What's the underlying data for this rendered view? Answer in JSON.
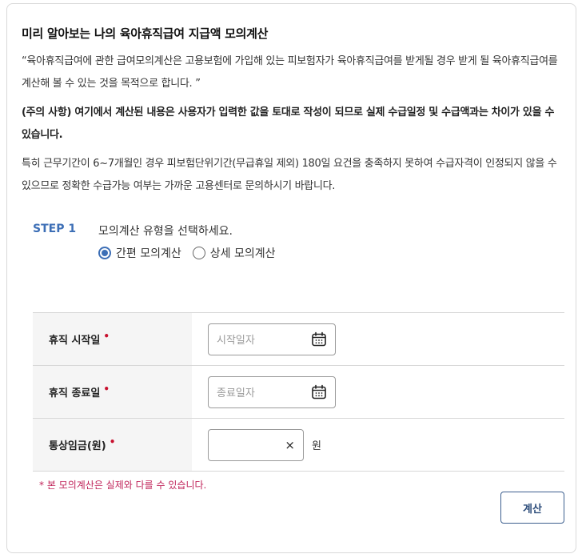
{
  "title": "미리 알아보는 나의 육아휴직급여 지급액 모의계산",
  "intro": "“육아휴직급여에 관한 급여모의계산은 고용보험에 가입해 있는 피보험자가 육아휴직급여를 받게될 경우 받게 될 육아휴직급여를 계산해 볼 수 있는 것을 목적으로 합니다. ”",
  "caution": "(주의 사항) 여기에서 계산된 내용은 사용자가 입력한 값을 토대로 작성이 되므로 실제 수급일정 및 수급액과는 차이가 있을 수 있습니다.",
  "notice": "특히 근무기간이 6~7개월인 경우 피보험단위기간(무급휴일 제외) 180일 요건을 충족하지 못하여 수급자격이 인정되지 않을 수 있으므로 정확한 수급가능 여부는 가까운 고용센터로 문의하시기 바랍니다.",
  "step": {
    "label": "STEP 1",
    "instruction": "모의계산 유형을 선택하세요.",
    "options": [
      {
        "label": "간편 모의계산",
        "selected": true
      },
      {
        "label": "상세 모의계산",
        "selected": false
      }
    ]
  },
  "form": {
    "required_mark": "•",
    "start_date": {
      "label": "휴직 시작일",
      "placeholder": "시작일자",
      "icon": "calendar-icon"
    },
    "end_date": {
      "label": "휴직 종료일",
      "placeholder": "종료일자",
      "icon": "calendar-icon"
    },
    "wage": {
      "label": "통상임금(원)",
      "value": "",
      "clear": "×",
      "unit": "원"
    }
  },
  "note": "* 본 모의계산은 실제와 다를 수 있습니다.",
  "calc_button": "계산",
  "colors": {
    "accent": "#3d6fb6",
    "required": "#c8102e",
    "note": "#c0245a",
    "button_border": "#3d5f8f"
  }
}
